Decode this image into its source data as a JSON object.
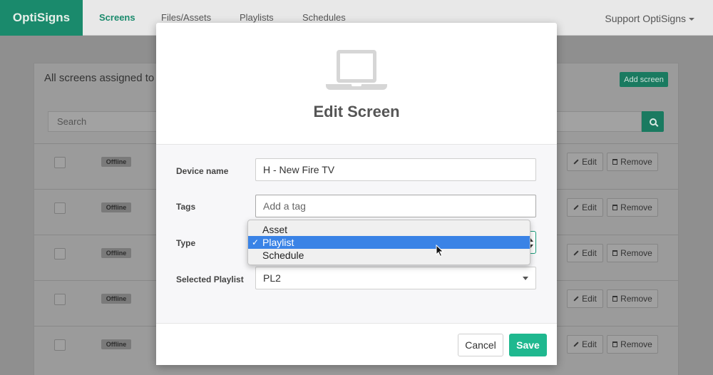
{
  "navbar": {
    "brand": "OptiSigns",
    "items": [
      {
        "label": "Screens",
        "active": true
      },
      {
        "label": "Files/Assets",
        "active": false
      },
      {
        "label": "Playlists",
        "active": false
      },
      {
        "label": "Schedules",
        "active": false
      }
    ],
    "support": "Support OptiSigns"
  },
  "background": {
    "title": "All screens assigned to",
    "add_screen": "Add screen",
    "search_placeholder": "Search",
    "rows": [
      {
        "status": "Offline",
        "edit": "Edit",
        "remove": "Remove"
      },
      {
        "status": "Offline",
        "edit": "Edit",
        "remove": "Remove"
      },
      {
        "status": "Offline",
        "edit": "Edit",
        "remove": "Remove"
      },
      {
        "status": "Offline",
        "edit": "Edit",
        "remove": "Remove"
      },
      {
        "status": "Offline",
        "edit": "Edit",
        "remove": "Remove"
      }
    ]
  },
  "modal": {
    "icon": "laptop-icon",
    "title": "Edit Screen",
    "fields": {
      "device_name_label": "Device name",
      "device_name_value": "H - New Fire TV",
      "tags_label": "Tags",
      "tags_placeholder": "Add a tag",
      "type_label": "Type",
      "type_value": "Playlist",
      "type_options": [
        "Asset",
        "Playlist",
        "Schedule"
      ],
      "playlist_label": "Selected Playlist",
      "playlist_value": "PL2"
    },
    "cancel": "Cancel",
    "save": "Save"
  },
  "colors": {
    "brand": "#1a8a6c",
    "save": "#1fb88f",
    "selected_option": "#3a83e6"
  }
}
